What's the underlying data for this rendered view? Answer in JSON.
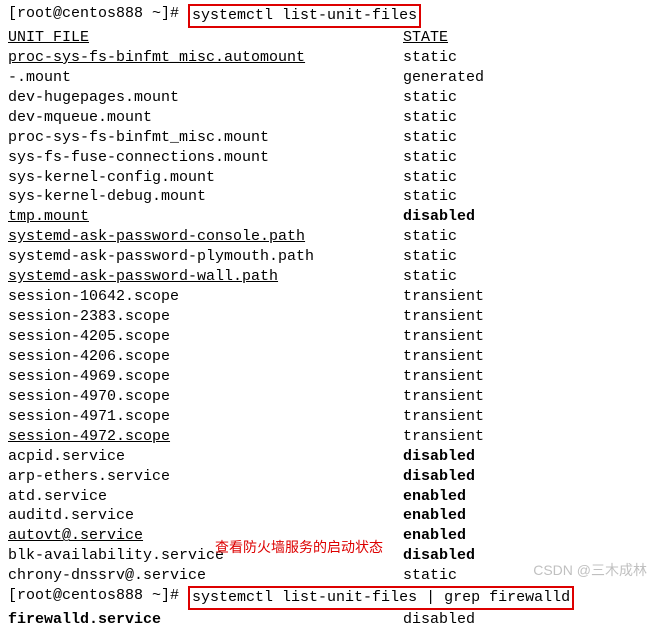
{
  "prompt1": {
    "prefix": "[root@centos888 ~]# ",
    "command": "systemctl list-unit-files"
  },
  "header": {
    "unit": "UNIT FILE",
    "state": "STATE"
  },
  "rows": [
    {
      "unit": "proc-sys-fs-binfmt_misc.automount",
      "state": "static",
      "u": true,
      "b": false
    },
    {
      "unit": "-.mount",
      "state": "generated",
      "u": false,
      "b": false
    },
    {
      "unit": "dev-hugepages.mount",
      "state": "static",
      "u": false,
      "b": false
    },
    {
      "unit": "dev-mqueue.mount",
      "state": "static",
      "u": false,
      "b": false
    },
    {
      "unit": "proc-sys-fs-binfmt_misc.mount",
      "state": "static",
      "u": false,
      "b": false
    },
    {
      "unit": "sys-fs-fuse-connections.mount",
      "state": "static",
      "u": false,
      "b": false
    },
    {
      "unit": "sys-kernel-config.mount",
      "state": "static",
      "u": false,
      "b": false
    },
    {
      "unit": "sys-kernel-debug.mount",
      "state": "static",
      "u": false,
      "b": false
    },
    {
      "unit": "tmp.mount",
      "state": "disabled",
      "u": true,
      "b": true
    },
    {
      "unit": "systemd-ask-password-console.path",
      "state": "static",
      "u": true,
      "b": false
    },
    {
      "unit": "systemd-ask-password-plymouth.path",
      "state": "static",
      "u": false,
      "b": false
    },
    {
      "unit": "systemd-ask-password-wall.path",
      "state": "static",
      "u": true,
      "b": false
    },
    {
      "unit": "session-10642.scope",
      "state": "transient",
      "u": false,
      "b": false
    },
    {
      "unit": "session-2383.scope",
      "state": "transient",
      "u": false,
      "b": false
    },
    {
      "unit": "session-4205.scope",
      "state": "transient",
      "u": false,
      "b": false
    },
    {
      "unit": "session-4206.scope",
      "state": "transient",
      "u": false,
      "b": false
    },
    {
      "unit": "session-4969.scope",
      "state": "transient",
      "u": false,
      "b": false
    },
    {
      "unit": "session-4970.scope",
      "state": "transient",
      "u": false,
      "b": false
    },
    {
      "unit": "session-4971.scope",
      "state": "transient",
      "u": false,
      "b": false
    },
    {
      "unit": "session-4972.scope",
      "state": "transient",
      "u": true,
      "b": false
    },
    {
      "unit": "acpid.service",
      "state": "disabled",
      "u": false,
      "b": true
    },
    {
      "unit": "arp-ethers.service",
      "state": "disabled",
      "u": false,
      "b": true
    },
    {
      "unit": "atd.service",
      "state": "enabled",
      "u": false,
      "b": true
    },
    {
      "unit": "auditd.service",
      "state": "enabled",
      "u": false,
      "b": true
    },
    {
      "unit": "autovt@.service",
      "state": "enabled",
      "u": true,
      "b": true
    },
    {
      "unit": "blk-availability.service",
      "state": "disabled",
      "u": false,
      "b": true
    },
    {
      "unit": "chrony-dnssrv@.service",
      "state": "static",
      "u": false,
      "b": false
    }
  ],
  "annotation": "查看防火墙服务的启动状态",
  "prompt2": {
    "prefix": "[root@centos888 ~]# ",
    "command": "systemctl list-unit-files | grep firewalld"
  },
  "result2": {
    "unit": "firewalld.service",
    "state": "disabled"
  },
  "watermark": "CSDN @三木成林"
}
